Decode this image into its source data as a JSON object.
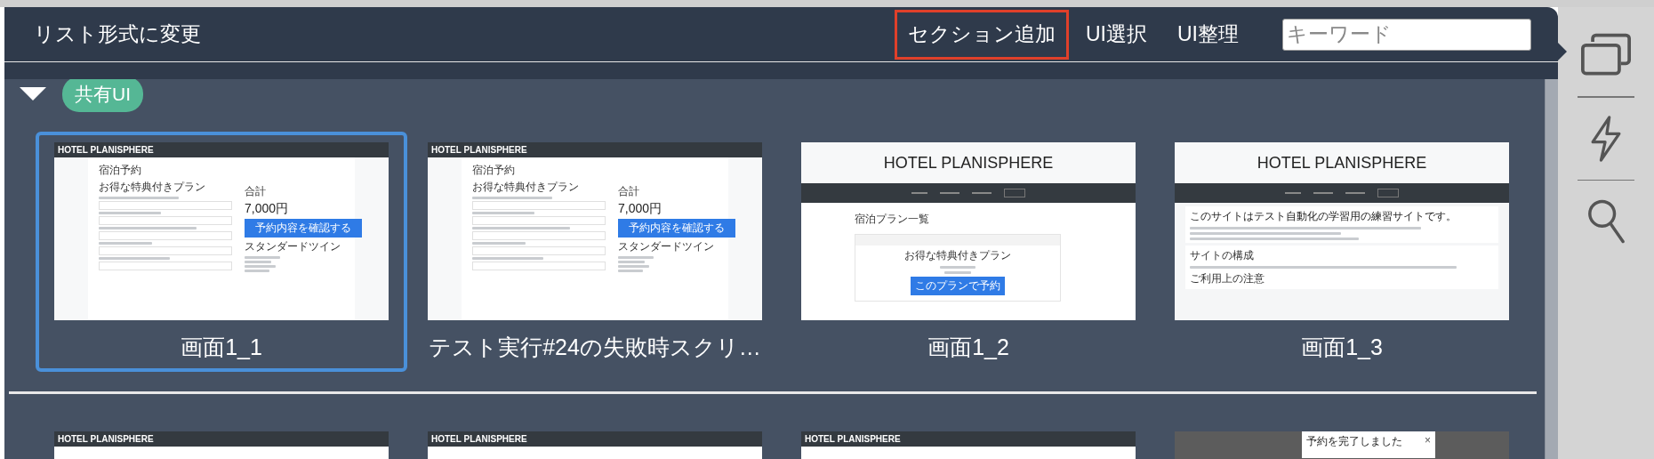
{
  "header": {
    "title": "リスト形式に変更",
    "actions": [
      {
        "label": "セクション追加",
        "highlighted": true
      },
      {
        "label": "UI選択",
        "highlighted": false
      },
      {
        "label": "UI整理",
        "highlighted": false
      }
    ],
    "search": {
      "placeholder": "キーワード"
    }
  },
  "section": {
    "title": "共有UI",
    "expanded": true,
    "rows": [
      [
        {
          "label": "画面1_1",
          "selected": true,
          "kind": "reservation",
          "header": "HOTEL PLANISPHERE",
          "title": "宿泊予約",
          "plan": "お得な特典付きプラン",
          "total_label": "合計",
          "total": "7,000円",
          "button": "予約内容を確認する",
          "room": "スタンダードツイン"
        },
        {
          "label": "テスト実行#24の失敗時スクリ…",
          "selected": false,
          "kind": "reservation",
          "header": "HOTEL PLANISPHERE",
          "title": "宿泊予約",
          "plan": "お得な特典付きプラン",
          "total_label": "合計",
          "total": "7,000円",
          "button": "予約内容を確認する",
          "room": "スタンダードツイン"
        },
        {
          "label": "画面1_2",
          "selected": false,
          "kind": "plans",
          "header": "HOTEL PLANISPHERE",
          "heading": "宿泊プラン一覧",
          "plan": "お得な特典付きプラン",
          "button": "このプランで予約"
        },
        {
          "label": "画面1_3",
          "selected": false,
          "kind": "home",
          "header": "HOTEL PLANISPHERE",
          "heading": "このサイトはテスト自動化の学習用の練習サイトです。",
          "section": "サイトの構成",
          "note": "ご利用上の注意"
        }
      ],
      [
        {
          "selected": false,
          "kind": "bar",
          "header": "HOTEL PLANISPHERE"
        },
        {
          "selected": false,
          "kind": "bar",
          "header": "HOTEL PLANISPHERE"
        },
        {
          "selected": false,
          "kind": "bar",
          "header": "HOTEL PLANISPHERE"
        },
        {
          "selected": false,
          "kind": "dialog",
          "message": "予約を完了しました",
          "close": "×"
        }
      ]
    ]
  }
}
